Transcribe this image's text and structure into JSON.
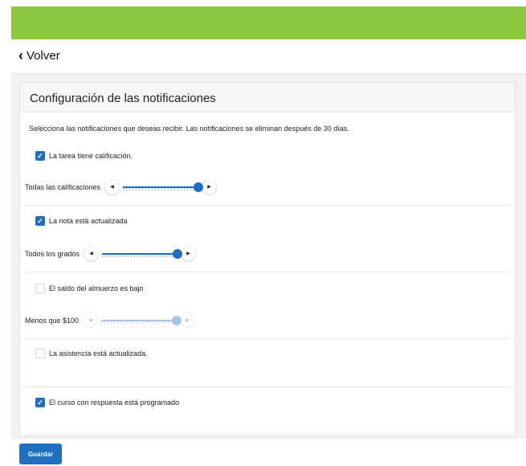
{
  "colors": {
    "brand_green": "#8dc63f",
    "accent_blue": "#1e6fc1",
    "disabled_blue": "#a9c4e3"
  },
  "nav": {
    "back_label": "Volver",
    "back_icon": "chevron-left-icon"
  },
  "card": {
    "title": "Configuración de las notificaciones",
    "intro": "Selecciona las notificaciones que deseas recibir. Las notificaciones se eliminan después de 30 días."
  },
  "notifications": [
    {
      "label": "La tarea tiene calificación.",
      "checked": true,
      "slider": {
        "label": "Todas las calificaciones",
        "level": 1.0,
        "enabled": true
      }
    },
    {
      "label": "La nota está actualizada",
      "checked": true,
      "slider": {
        "label": "Todos los grados",
        "level": 1.0,
        "enabled": true
      }
    },
    {
      "label": "El saldo del almuerzo es bajo",
      "checked": false,
      "slider": {
        "label": "Menos que $100",
        "level": 1.0,
        "enabled": false
      }
    },
    {
      "label": "La asistencia está actualizada.",
      "checked": false
    },
    {
      "label": "El curso con respuesta está programado",
      "checked": true
    }
  ],
  "footer": {
    "save_label": "Guardar"
  }
}
